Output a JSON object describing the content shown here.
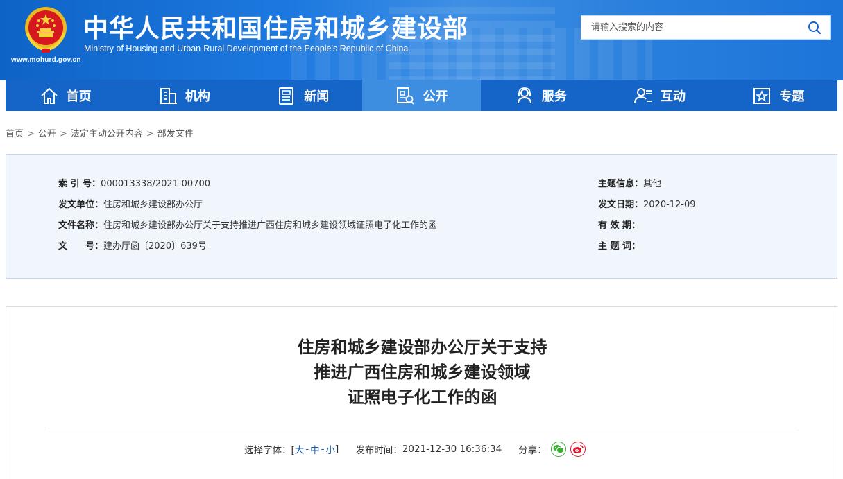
{
  "header": {
    "title": "中华人民共和国住房和城乡建设部",
    "subtitle": "Ministry of Housing and Urban-Rural Development of the People’s Republic of China",
    "url": "www.mohurd.gov.cn",
    "search_placeholder": "请输入搜索的内容"
  },
  "nav": {
    "items": [
      {
        "label": "首页",
        "icon": "home-icon"
      },
      {
        "label": "机构",
        "icon": "building-icon"
      },
      {
        "label": "新闻",
        "icon": "news-icon"
      },
      {
        "label": "公开",
        "icon": "document-icon",
        "active": true
      },
      {
        "label": "服务",
        "icon": "service-icon"
      },
      {
        "label": "互动",
        "icon": "chat-user-icon"
      },
      {
        "label": "专题",
        "icon": "star-icon"
      }
    ]
  },
  "breadcrumb": [
    "首页",
    "公开",
    "法定主动公开内容",
    "部发文件"
  ],
  "breadcrumb_sep": ">",
  "info": {
    "index_label": "索 引 号：",
    "index_value": "000013338/2021-00700",
    "issuer_label": "发文单位：",
    "issuer_value": "住房和城乡建设部办公厅",
    "docname_label": "文件名称：",
    "docname_value": "住房和城乡建设部办公厅关于支持推进广西住房和城乡建设领域证照电子化工作的函",
    "docno_label": "文　　号：",
    "docno_value": "建办厅函〔2020〕639号",
    "topic_label": "主题信息：",
    "topic_value": "其他",
    "date_label": "发文日期：",
    "date_value": "2020-12-09",
    "valid_label": "有 效 期：",
    "valid_value": "",
    "keywords_label": "主 题 词：",
    "keywords_value": ""
  },
  "article": {
    "title_lines": [
      "住房和城乡建设部办公厅关于支持",
      "推进广西住房和城乡建设领域",
      "证照电子化工作的函"
    ],
    "font_label": "选择字体：[",
    "font_large": "大",
    "font_medium": "中",
    "font_small": "小",
    "font_close": "]",
    "publish_label": "发布时间：",
    "publish_value": "2021-12-30 16:36:34",
    "share_label": "分享："
  },
  "colors": {
    "nav_bg": "#1565c8",
    "nav_active": "#3d8de0",
    "wechat": "#3cb034",
    "weibo": "#e6162d"
  }
}
